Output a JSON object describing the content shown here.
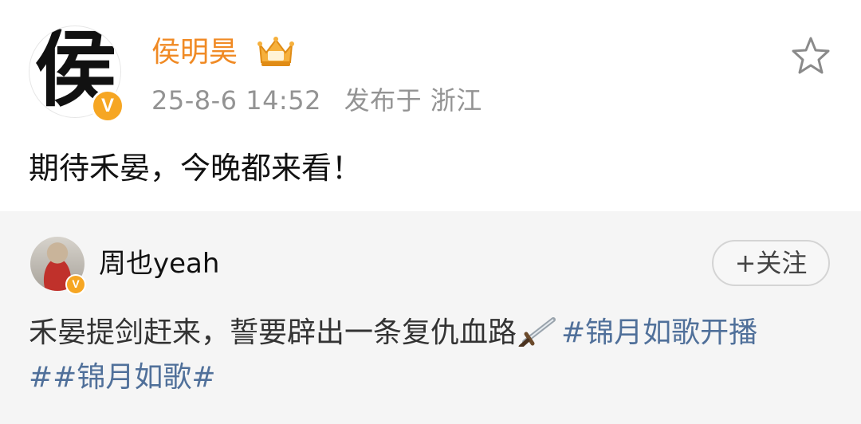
{
  "post": {
    "avatar_char": "侯",
    "verified_badge": "V",
    "author": "侯明昊",
    "time": "25-8-6 14:52",
    "location": "发布于 浙江",
    "text": "期待禾晏，今晚都来看！",
    "icons": {
      "crown": "crown-icon",
      "favorite": "star-icon"
    }
  },
  "repost": {
    "verified_badge": "V",
    "author": "周也yeah",
    "follow_label": "+关注",
    "text": "禾晏提剑赶来，誓要辟出一条复仇血路",
    "emoji": "sword-icon",
    "hashtags": [
      "#锦月如歌开播",
      "##锦月如歌#"
    ]
  },
  "colors": {
    "name_orange": "#f08a24",
    "link_blue": "#50709a",
    "repost_bg": "#f5f5f5",
    "badge": "#f6a623"
  }
}
